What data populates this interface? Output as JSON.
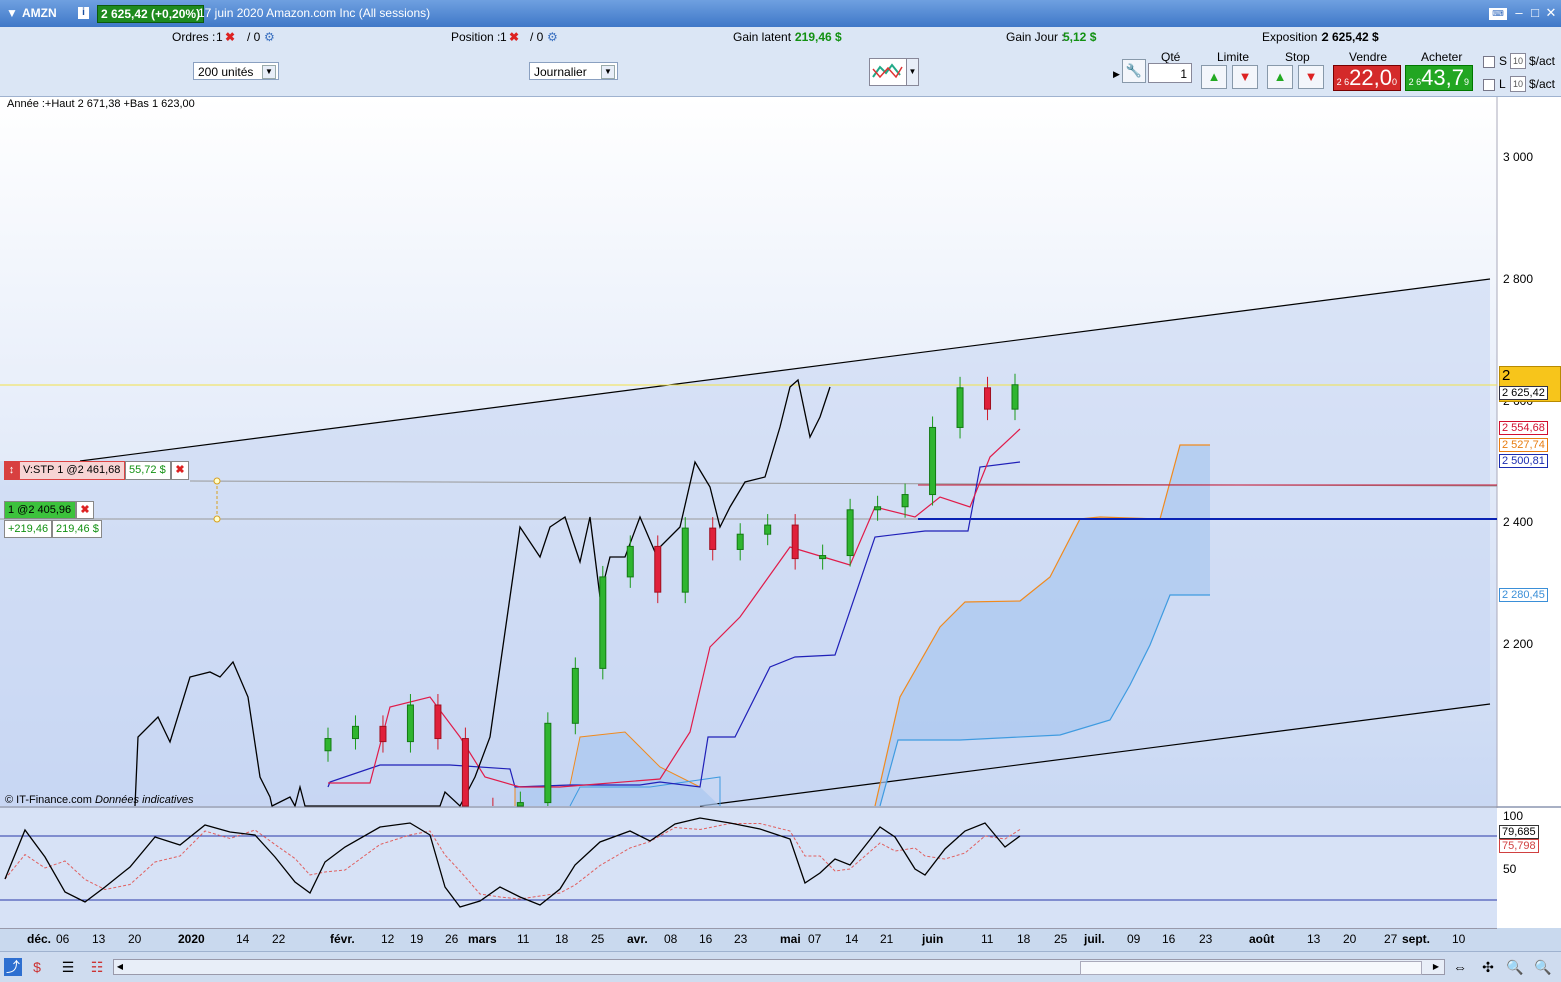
{
  "title_bar": {
    "symbol": "AMZN",
    "price_badge": "2 625,42 (+0,20%)",
    "description": "17 juin 2020 Amazon.com Inc (All sessions)"
  },
  "info_bar": {
    "orders_label": "Ordres :",
    "orders_value": "1",
    "orders_sep": "/ 0",
    "position_label": "Position :",
    "position_value": "1",
    "position_sep": "/ 0",
    "gain_latent_label": "Gain latent :",
    "gain_latent_value": "219,46 $",
    "gain_jour_label": "Gain Jour :",
    "gain_jour_value": "5,12 $",
    "exposition_label": "Exposition :",
    "exposition_value": "2 625,42 $"
  },
  "toolbar": {
    "units_select": "200 unités",
    "period_select": "Journalier"
  },
  "order_panel": {
    "qty_label": "Qté",
    "qty_value": "1",
    "limit_label": "Limite",
    "stop_label": "Stop",
    "sell_label": "Vendre",
    "buy_label": "Acheter",
    "sell_price_small": "2 6",
    "sell_price_big": "22,0",
    "sell_price_sup": "0",
    "buy_price_small": "2 6",
    "buy_price_big": "43,7",
    "buy_price_sup": "9",
    "s_label": "S",
    "l_label": "L",
    "s_spin": "10",
    "l_spin": "10",
    "unit_s": "$/act",
    "unit_l": "$/act",
    "colors": {
      "sell": "#d42a2a",
      "buy": "#22a622"
    }
  },
  "chart": {
    "info_text": "Année :+Haut 2 671,38 +Bas 1 623,00",
    "copyright": "© IT-Finance.com",
    "disclaimer": "Données indicatives",
    "price_axis": [
      "3 000",
      "2 800",
      "2 600",
      "2 400",
      "2 200"
    ],
    "osc_axis": [
      "100",
      "50"
    ],
    "price_tags": {
      "last_big": "2 625,42",
      "last_small": "2 625,42",
      "red": "2 554,68",
      "orange": "2 527,74",
      "blue": "2 500,81",
      "lightblue": "2 280,45",
      "osc_black": "79,685",
      "osc_red": "75,798"
    },
    "stop_order": {
      "label": "V:STP  1 @2 461,68",
      "value": "55,72 $"
    },
    "position": {
      "label": "1 @2 405,96",
      "gain1": "+219,46",
      "gain2": "219,46 $"
    },
    "x_labels": [
      "déc.",
      "06",
      "13",
      "20",
      "2020",
      "14",
      "22",
      "févr.",
      "12",
      "19",
      "26",
      "mars",
      "11",
      "18",
      "25",
      "avr.",
      "08",
      "16",
      "23",
      "mai",
      "07",
      "14",
      "21",
      "juin",
      "11",
      "18",
      "25",
      "juil.",
      "09",
      "16",
      "23",
      "août",
      "13",
      "20",
      "27",
      "sept.",
      "10"
    ]
  },
  "chart_data": {
    "type": "line",
    "title": "",
    "series": [
      {
        "values": [
          1740,
          1790,
          1905,
          1895,
          1895,
          1880,
          1755,
          1725,
          1785,
          1805,
          1760,
          1790,
          1820,
          2205,
          2245,
          2350,
          2395,
          2400,
          2465,
          2450,
          2525,
          2545,
          2615,
          2565,
          2595,
          2575
        ]
      },
      {
        "values": [
          2045,
          2065,
          2040,
          2100,
          2045,
          1930,
          1910,
          1940,
          2070,
          2160,
          2310,
          2360,
          2285,
          2390,
          2355,
          2380,
          2395,
          2340,
          2345,
          2420,
          2425,
          2445,
          2555,
          2620,
          2585,
          2625
        ]
      }
    ],
    "osc_series": {
      "k_last": 79.685,
      "d_last": 75.798,
      "levels": [
        80,
        20
      ]
    },
    "ylim": [
      1950,
      3100
    ]
  }
}
